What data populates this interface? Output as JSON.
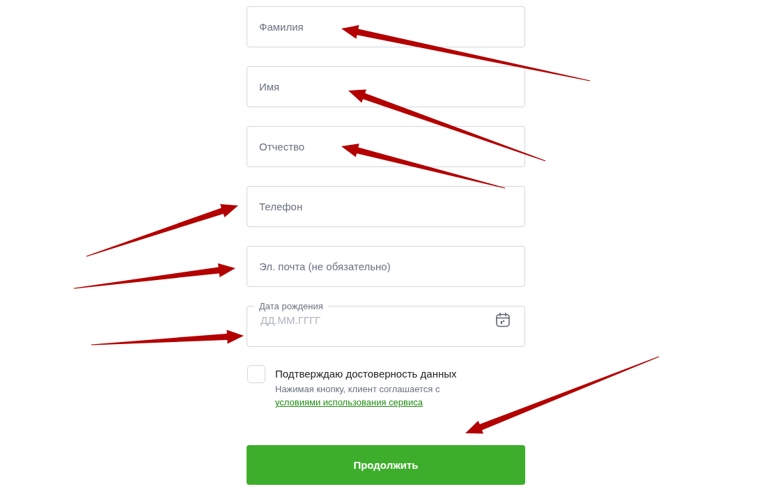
{
  "fields": [
    {
      "kind": "text",
      "placeholder": "Фамилия"
    },
    {
      "kind": "text",
      "placeholder": "Имя"
    },
    {
      "kind": "text",
      "placeholder": "Отчество"
    },
    {
      "kind": "text",
      "placeholder": "Телефон"
    },
    {
      "kind": "text",
      "placeholder": "Эл. почта (не обязательно)"
    },
    {
      "kind": "date",
      "label": "Дата рождения",
      "placeholder": "ДД.ММ.ГГГГ"
    }
  ],
  "consent": {
    "checked": false,
    "label": "Подтверждаю достоверность данных",
    "note": "Нажимая кнопку, клиент соглашается с",
    "link": "условиями использования сервиса"
  },
  "submit": "Продолжить"
}
